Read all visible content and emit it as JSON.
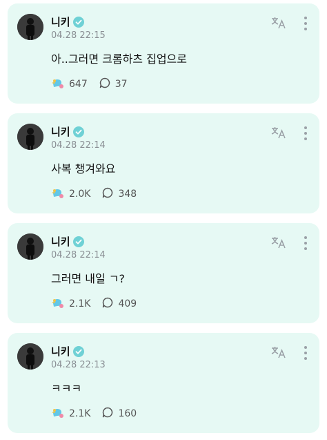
{
  "colors": {
    "card_bg": "#e6f9f4",
    "verified": "#6fd1d5",
    "text": "#111111",
    "meta": "#8a8f94"
  },
  "posts": [
    {
      "author": "니키",
      "timestamp": "04.28 22:15",
      "text": "아..그러면 크롬하츠 집업으로",
      "likes": "647",
      "comments": "37"
    },
    {
      "author": "니키",
      "timestamp": "04.28 22:14",
      "text": "사복 챙겨와요",
      "likes": "2.0K",
      "comments": "348"
    },
    {
      "author": "니키",
      "timestamp": "04.28 22:14",
      "text": "그러면 내일 ㄱ?",
      "likes": "2.1K",
      "comments": "409"
    },
    {
      "author": "니키",
      "timestamp": "04.28 22:13",
      "text": "ㅋㅋㅋ",
      "likes": "2.1K",
      "comments": "160"
    }
  ]
}
